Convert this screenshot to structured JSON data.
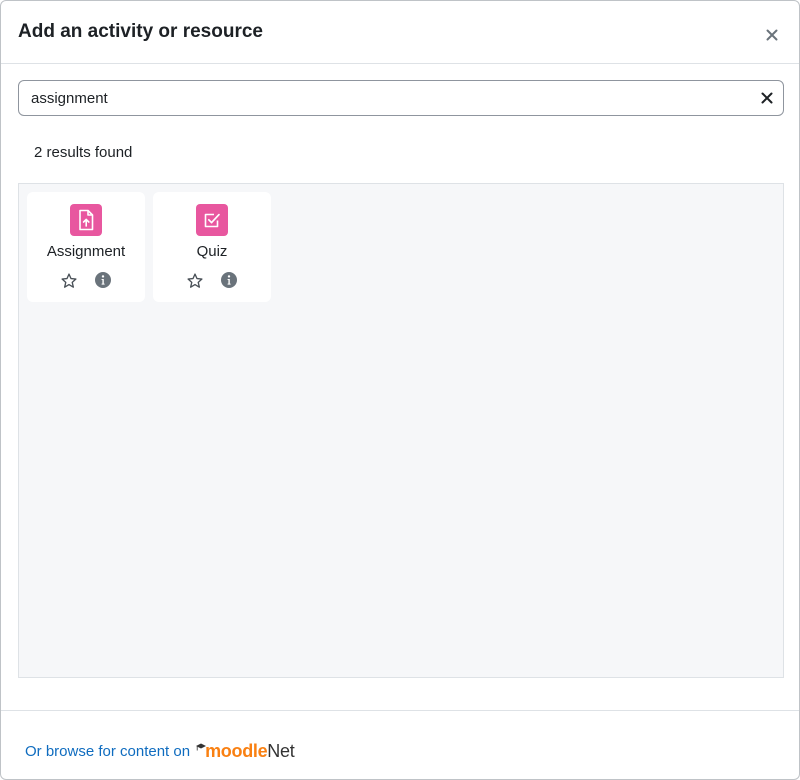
{
  "modal": {
    "title": "Add an activity or resource"
  },
  "search": {
    "value": "assignment",
    "placeholder": "Search"
  },
  "results": {
    "count_text": "2 results found",
    "items": [
      {
        "label": "Assignment",
        "icon": "assignment-upload-icon",
        "icon_color": "#e8579f"
      },
      {
        "label": "Quiz",
        "icon": "quiz-checkbox-icon",
        "icon_color": "#e8579f"
      }
    ]
  },
  "footer": {
    "browse_text": "Or browse for content on",
    "logo_moodle": "moodle",
    "logo_net": "Net"
  },
  "colors": {
    "link": "#0f6cbf",
    "activity_icon_bg": "#e8579f",
    "moodle_orange": "#f98012"
  }
}
